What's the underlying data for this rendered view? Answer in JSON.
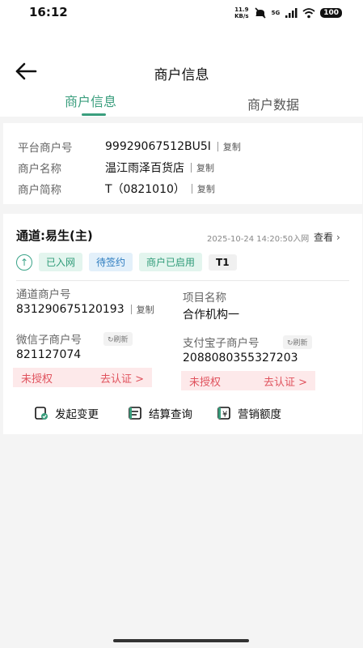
{
  "status_bar": {
    "time": "16:12",
    "net_speed_value": "11.9",
    "net_speed_unit": "KB/s",
    "network": "5G",
    "battery": "100",
    "icons": [
      "mute-icon",
      "signal-icon",
      "wifi-icon",
      "battery-icon"
    ]
  },
  "header": {
    "title": "商户信息",
    "back_icon": "back-arrow-icon"
  },
  "tabs": [
    {
      "label": "商户信息",
      "active": true
    },
    {
      "label": "商户数据",
      "active": false
    }
  ],
  "merchant": {
    "rows": [
      {
        "label": "平台商户号",
        "value": "99929067512BU5I",
        "action": "复制"
      },
      {
        "label": "商户名称",
        "value": "温江雨泽百货店",
        "action": "复制"
      },
      {
        "label": "商户简称",
        "value": "T（0821010）",
        "action": "复制"
      }
    ]
  },
  "channel": {
    "title": "通道:易生(主)",
    "time_text": "2025-10-24 14:20:50入网",
    "view_label": "查看",
    "tags": [
      {
        "label": "已入网",
        "style": "green"
      },
      {
        "label": "待签约",
        "style": "blue"
      },
      {
        "label": "商户已启用",
        "style": "green"
      },
      {
        "label": "T1",
        "style": "gray"
      }
    ],
    "channel_merchant_no": {
      "label": "通道商户号",
      "value": "831290675120193",
      "action": "复制"
    },
    "project_name": {
      "label": "项目名称",
      "value": "合作机构一"
    },
    "wechat": {
      "label": "微信子商户号",
      "refresh": "刷新",
      "value": "821127074",
      "auth_status": "未授权",
      "auth_link": "去认证 >"
    },
    "alipay": {
      "label": "支付宝子商户号",
      "refresh": "刷新",
      "value": "2088080355327203",
      "auth_status": "未授权",
      "auth_link": "去认证 >"
    },
    "actions": [
      {
        "label": "发起变更",
        "icon": "change-icon"
      },
      {
        "label": "结算查询",
        "icon": "settlement-icon"
      },
      {
        "label": "营销额度",
        "icon": "yuan-icon"
      }
    ]
  },
  "colors": {
    "accent": "#3a9e7d",
    "warn": "#e0525d",
    "tag_blue": "#2c7bbf"
  }
}
